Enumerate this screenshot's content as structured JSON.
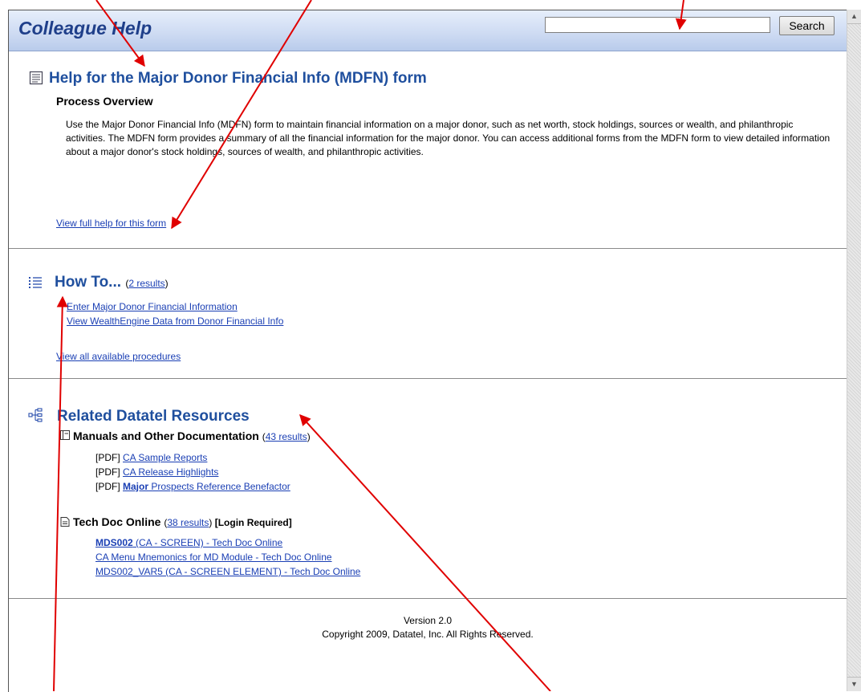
{
  "header": {
    "title": "Colleague Help",
    "search_placeholder": "",
    "search_button": "Search"
  },
  "form_help": {
    "title": "Help for the Major Donor Financial Info (MDFN) form",
    "subtitle": "Process Overview",
    "description": "Use the Major Donor Financial Info (MDFN) form to maintain financial information on a major donor, such as net worth, stock holdings, sources or wealth, and philanthropic activities. The MDFN form provides a summary of all the financial information for the major donor. You can access additional forms from the MDFN form to view detailed information about a major donor's stock holdings, sources of wealth, and philanthropic activities.",
    "full_help_link": "View full help for this form"
  },
  "how_to": {
    "title": "How To...",
    "results_link": "2 results",
    "items": [
      "Enter Major Donor Financial Information",
      "View WealthEngine Data from Donor Financial Info"
    ],
    "all_link": "View all available procedures"
  },
  "resources": {
    "title": "Related Datatel Resources",
    "manuals": {
      "title": "Manuals and Other Documentation",
      "results_link": "43 results",
      "items": [
        {
          "prefix": "[PDF]",
          "label": "CA Sample Reports"
        },
        {
          "prefix": "[PDF]",
          "label": "CA Release Highlights"
        },
        {
          "prefix": "[PDF]",
          "label_bold": "Major",
          "label_rest": " Prospects Reference Benefactor"
        }
      ]
    },
    "techdoc": {
      "title": "Tech Doc Online",
      "results_link": "38 results",
      "note": "[Login Required]",
      "items": [
        {
          "label_bold": "MDS002",
          "label_rest": " (CA - SCREEN) - Tech Doc Online"
        },
        {
          "label": "CA Menu Mnemonics for MD Module - Tech Doc Online"
        },
        {
          "label": "MDS002_VAR5 (CA - SCREEN ELEMENT) - Tech Doc Online"
        }
      ]
    }
  },
  "footer": {
    "version": "Version 2.0",
    "copyright": "Copyright 2009, Datatel, Inc. All Rights Reserved."
  },
  "colors": {
    "header_title": "#1f3f8a",
    "section_title": "#1f4f9e",
    "link": "#1a3fb4",
    "annotation_arrow": "#e00000"
  }
}
